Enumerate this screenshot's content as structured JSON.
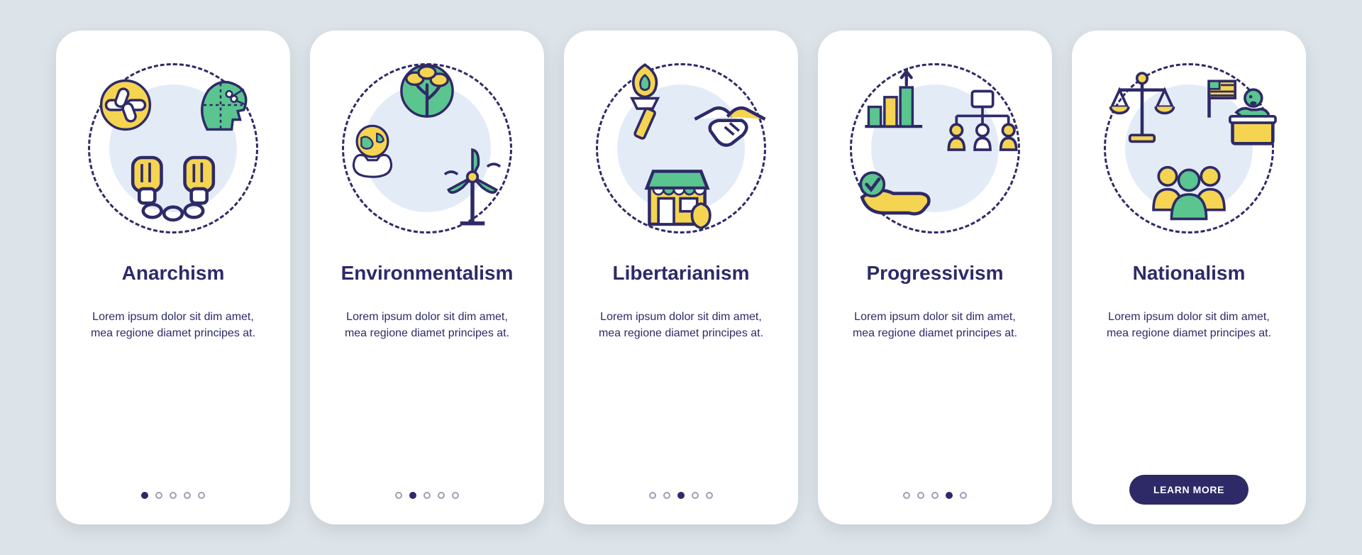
{
  "colors": {
    "ink": "#2e2a68",
    "yellow": "#f5d451",
    "green": "#5bc58f",
    "pale": "#e3ecf6",
    "bg": "#dce4ea"
  },
  "cards": [
    {
      "title": "Anarchism",
      "desc": "Lorem ipsum dolor sit dim amet, mea regione diamet principes at.",
      "activeDot": 0,
      "hasButton": false
    },
    {
      "title": "Environmentalism",
      "desc": "Lorem ipsum dolor sit dim amet, mea regione diamet principes at.",
      "activeDot": 1,
      "hasButton": false
    },
    {
      "title": "Libertarianism",
      "desc": "Lorem ipsum dolor sit dim amet, mea regione diamet principes at.",
      "activeDot": 2,
      "hasButton": false
    },
    {
      "title": "Progressivism",
      "desc": "Lorem ipsum dolor sit dim amet, mea regione diamet principes at.",
      "activeDot": 3,
      "hasButton": false
    },
    {
      "title": "Nationalism",
      "desc": "Lorem ipsum dolor sit dim amet, mea regione diamet principes at.",
      "activeDot": 4,
      "hasButton": true,
      "buttonLabel": "LEARN MORE"
    }
  ]
}
